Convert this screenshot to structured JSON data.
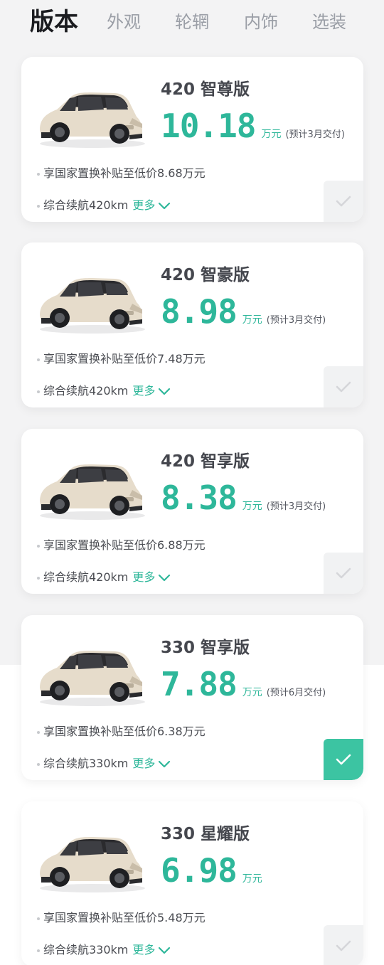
{
  "tabs": [
    {
      "label": "版本",
      "active": true
    },
    {
      "label": "外观",
      "active": false
    },
    {
      "label": "轮辋",
      "active": false
    },
    {
      "label": "内饰",
      "active": false
    },
    {
      "label": "选装",
      "active": false
    }
  ],
  "versions": [
    {
      "name": "420 智尊版",
      "price": "10.18",
      "unit": "万元",
      "delivery": "(预计3月交付)",
      "subsidy": "享国家置换补贴至低价8.68万元",
      "range": "综合续航420km",
      "more": "更多",
      "selected": false
    },
    {
      "name": "420 智豪版",
      "price": "8.98",
      "unit": "万元",
      "delivery": "(预计3月交付)",
      "subsidy": "享国家置换补贴至低价7.48万元",
      "range": "综合续航420km",
      "more": "更多",
      "selected": false
    },
    {
      "name": "420 智享版",
      "price": "8.38",
      "unit": "万元",
      "delivery": "(预计3月交付)",
      "subsidy": "享国家置换补贴至低价6.88万元",
      "range": "综合续航420km",
      "more": "更多",
      "selected": false
    },
    {
      "name": "330 智享版",
      "price": "7.88",
      "unit": "万元",
      "delivery": "(预计6月交付)",
      "subsidy": "享国家置换补贴至低价6.38万元",
      "range": "综合续航330km",
      "more": "更多",
      "selected": true
    },
    {
      "name": "330 星耀版",
      "price": "6.98",
      "unit": "万元",
      "delivery": "",
      "subsidy": "享国家置换补贴至低价5.48万元",
      "range": "综合续航330km",
      "more": "更多",
      "selected": false
    }
  ],
  "icons": {
    "car": "car-image",
    "chevron": "chevron-down-icon",
    "check": "check-icon"
  },
  "colors": {
    "accent": "#2eb79a",
    "selected_bg": "#3cc4a2",
    "unselected_bg": "#f1f2f3"
  }
}
